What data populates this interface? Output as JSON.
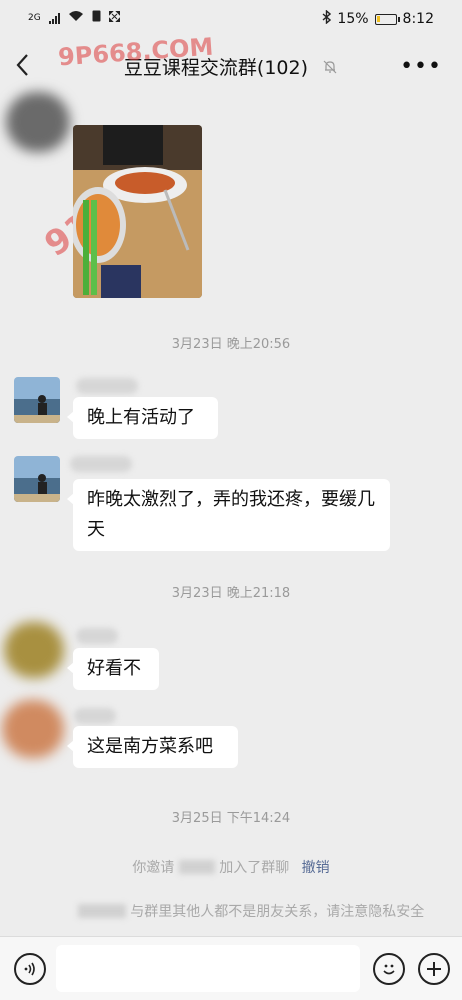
{
  "status_bar": {
    "network": "2G",
    "battery": "15%",
    "time": "8:12"
  },
  "header": {
    "title": "豆豆课程交流群(102)"
  },
  "watermarks": [
    "9P668.COM",
    "91P.COM"
  ],
  "messages": [
    {
      "type": "time",
      "text": "3月23日 晚上20:56"
    },
    {
      "type": "text",
      "text": "晚上有活动了"
    },
    {
      "type": "text",
      "text": "昨晚太激烈了，弄的我还疼，要缓几天"
    },
    {
      "type": "time",
      "text": "3月23日 晚上21:18"
    },
    {
      "type": "text",
      "text": "好看不"
    },
    {
      "type": "text",
      "text": "这是南方菜系吧"
    },
    {
      "type": "time",
      "text": "3月25日 下午14:24"
    }
  ],
  "system_notice": {
    "invite_prefix": "你邀请",
    "invite_suffix": "加入了群聊",
    "undo_label": "撤销",
    "privacy_text": "与群里其他人都不是朋友关系，请注意隐私安全"
  },
  "colors": {
    "background": "#ededed",
    "link": "#576b95",
    "watermark": "#dc3c3c"
  }
}
